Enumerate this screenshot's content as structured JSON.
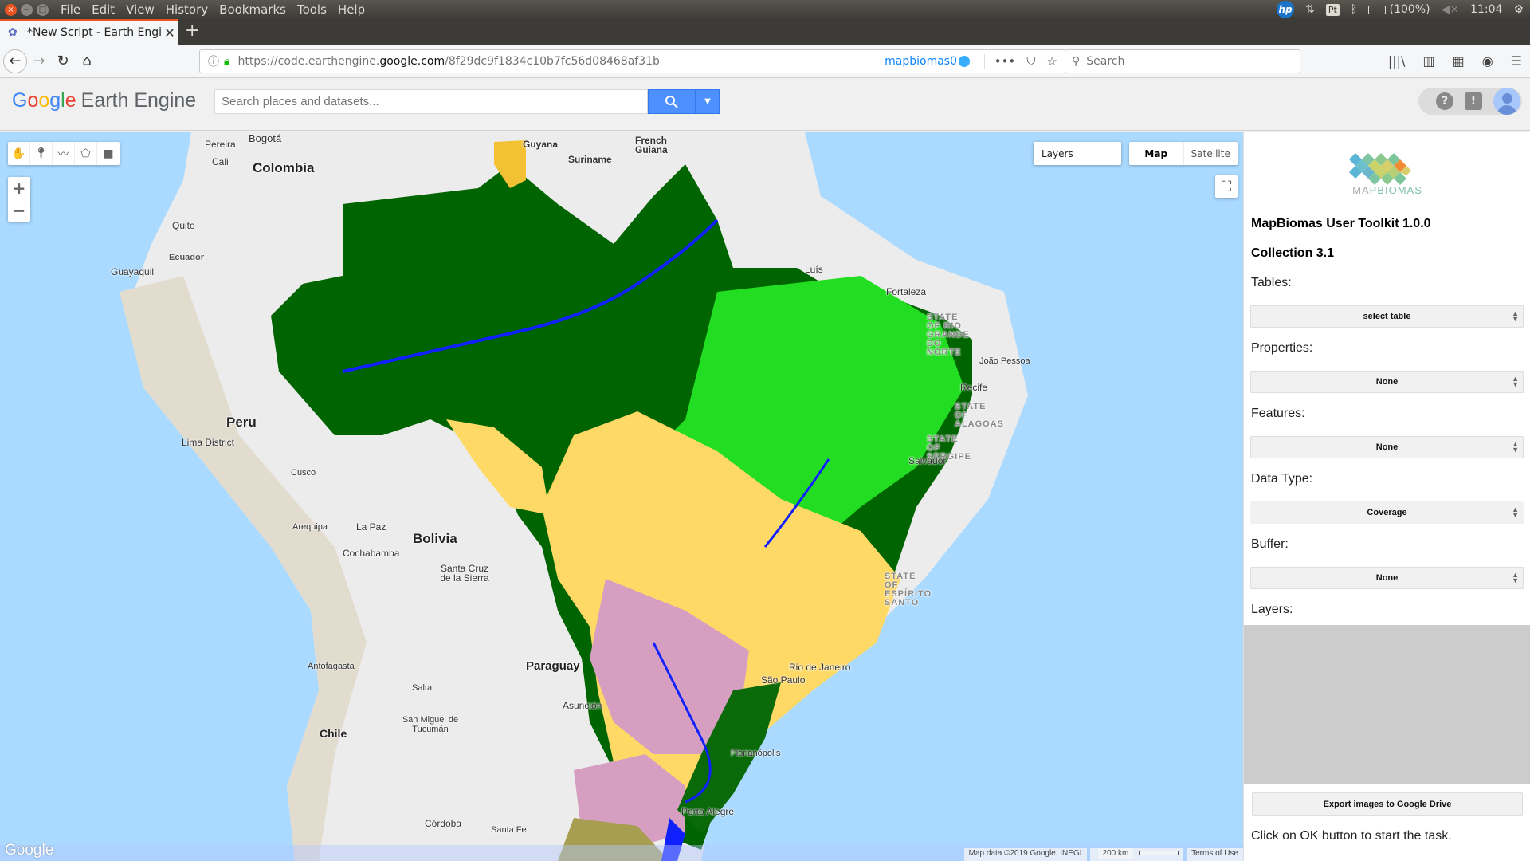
{
  "os": {
    "menus": [
      "File",
      "Edit",
      "View",
      "History",
      "Bookmarks",
      "Tools",
      "Help"
    ],
    "tray": {
      "hp_label": "hp",
      "keyboard": "Pt",
      "battery": "(100%)",
      "time": "11:04"
    }
  },
  "browser": {
    "tab_title": "*New Script - Earth Engi",
    "url_prefix": "https://code.earthengine.",
    "url_domain": "google.com",
    "url_path": "/8f29dc9f1834c10b7fc56d08468af31b",
    "container_label": "mapbiomas0",
    "search_placeholder": "Search"
  },
  "gee": {
    "logo": {
      "g1": "G",
      "g2": "o",
      "g3": "o",
      "g4": "g",
      "g5": "l",
      "g6": "e",
      "product": "Earth Engine"
    },
    "search_placeholder": "Search places and datasets..."
  },
  "map": {
    "layers_label": "Layers",
    "map_type": {
      "active": "Map",
      "inactive": "Satellite"
    },
    "zoom_in": "+",
    "zoom_out": "−",
    "google_logo": "Google",
    "attribution": "Map data ©2019 Google, INEGI",
    "scale": "200 km",
    "terms": "Terms of Use",
    "labels": {
      "countries": [
        "Colombia",
        "Peru",
        "Bolivia",
        "Paraguay",
        "Chile"
      ],
      "cities": [
        "Pereira",
        "Bogotá",
        "Cali",
        "Quito",
        "Ecuador",
        "Guayaquil",
        "Lima District",
        "Cusco",
        "Arequipa",
        "La Paz",
        "Cochabamba",
        "Santa Cruz de la Sierra",
        "Antofagasta",
        "Salta",
        "San Miguel de Tucumán",
        "Asunción",
        "Córdoba",
        "Santa Fe",
        "Guyana",
        "Suriname",
        "French Guiana",
        "Luís",
        "Fortaleza",
        "João Pessoa",
        "Recife",
        "Salvador",
        "Rio de Janeiro",
        "São Paulo",
        "Florianópolis",
        "Porto Alegre"
      ],
      "states": [
        "STATE OF RIO GRANDE DO NORTE",
        "STATE OF ALAGOAS",
        "STATE OF SERGIPE",
        "STATE OF ESPÍRITO SANTO"
      ]
    },
    "legend_colors": {
      "forest": "#006400",
      "savanna": "#00ff00",
      "agriculture": "#ffd966",
      "pasture": "#e974ed",
      "water": "#0000ff",
      "mosaic": "#b8af4f",
      "urban": "#aa0000"
    }
  },
  "panel": {
    "logo_text_a": "MA",
    "logo_text_b": "PBIOMAS",
    "title": "MapBiomas User Toolkit 1.0.0",
    "collection": "Collection 3.1",
    "tables_label": "Tables:",
    "tables_value": "select table",
    "properties_label": "Properties:",
    "properties_value": "None",
    "features_label": "Features:",
    "features_value": "None",
    "datatype_label": "Data Type:",
    "datatype_value": "Coverage",
    "buffer_label": "Buffer:",
    "buffer_value": "None",
    "layers_label": "Layers:",
    "export_button": "Export images to Google Drive",
    "ok_message": "Click on OK button to start the task."
  }
}
